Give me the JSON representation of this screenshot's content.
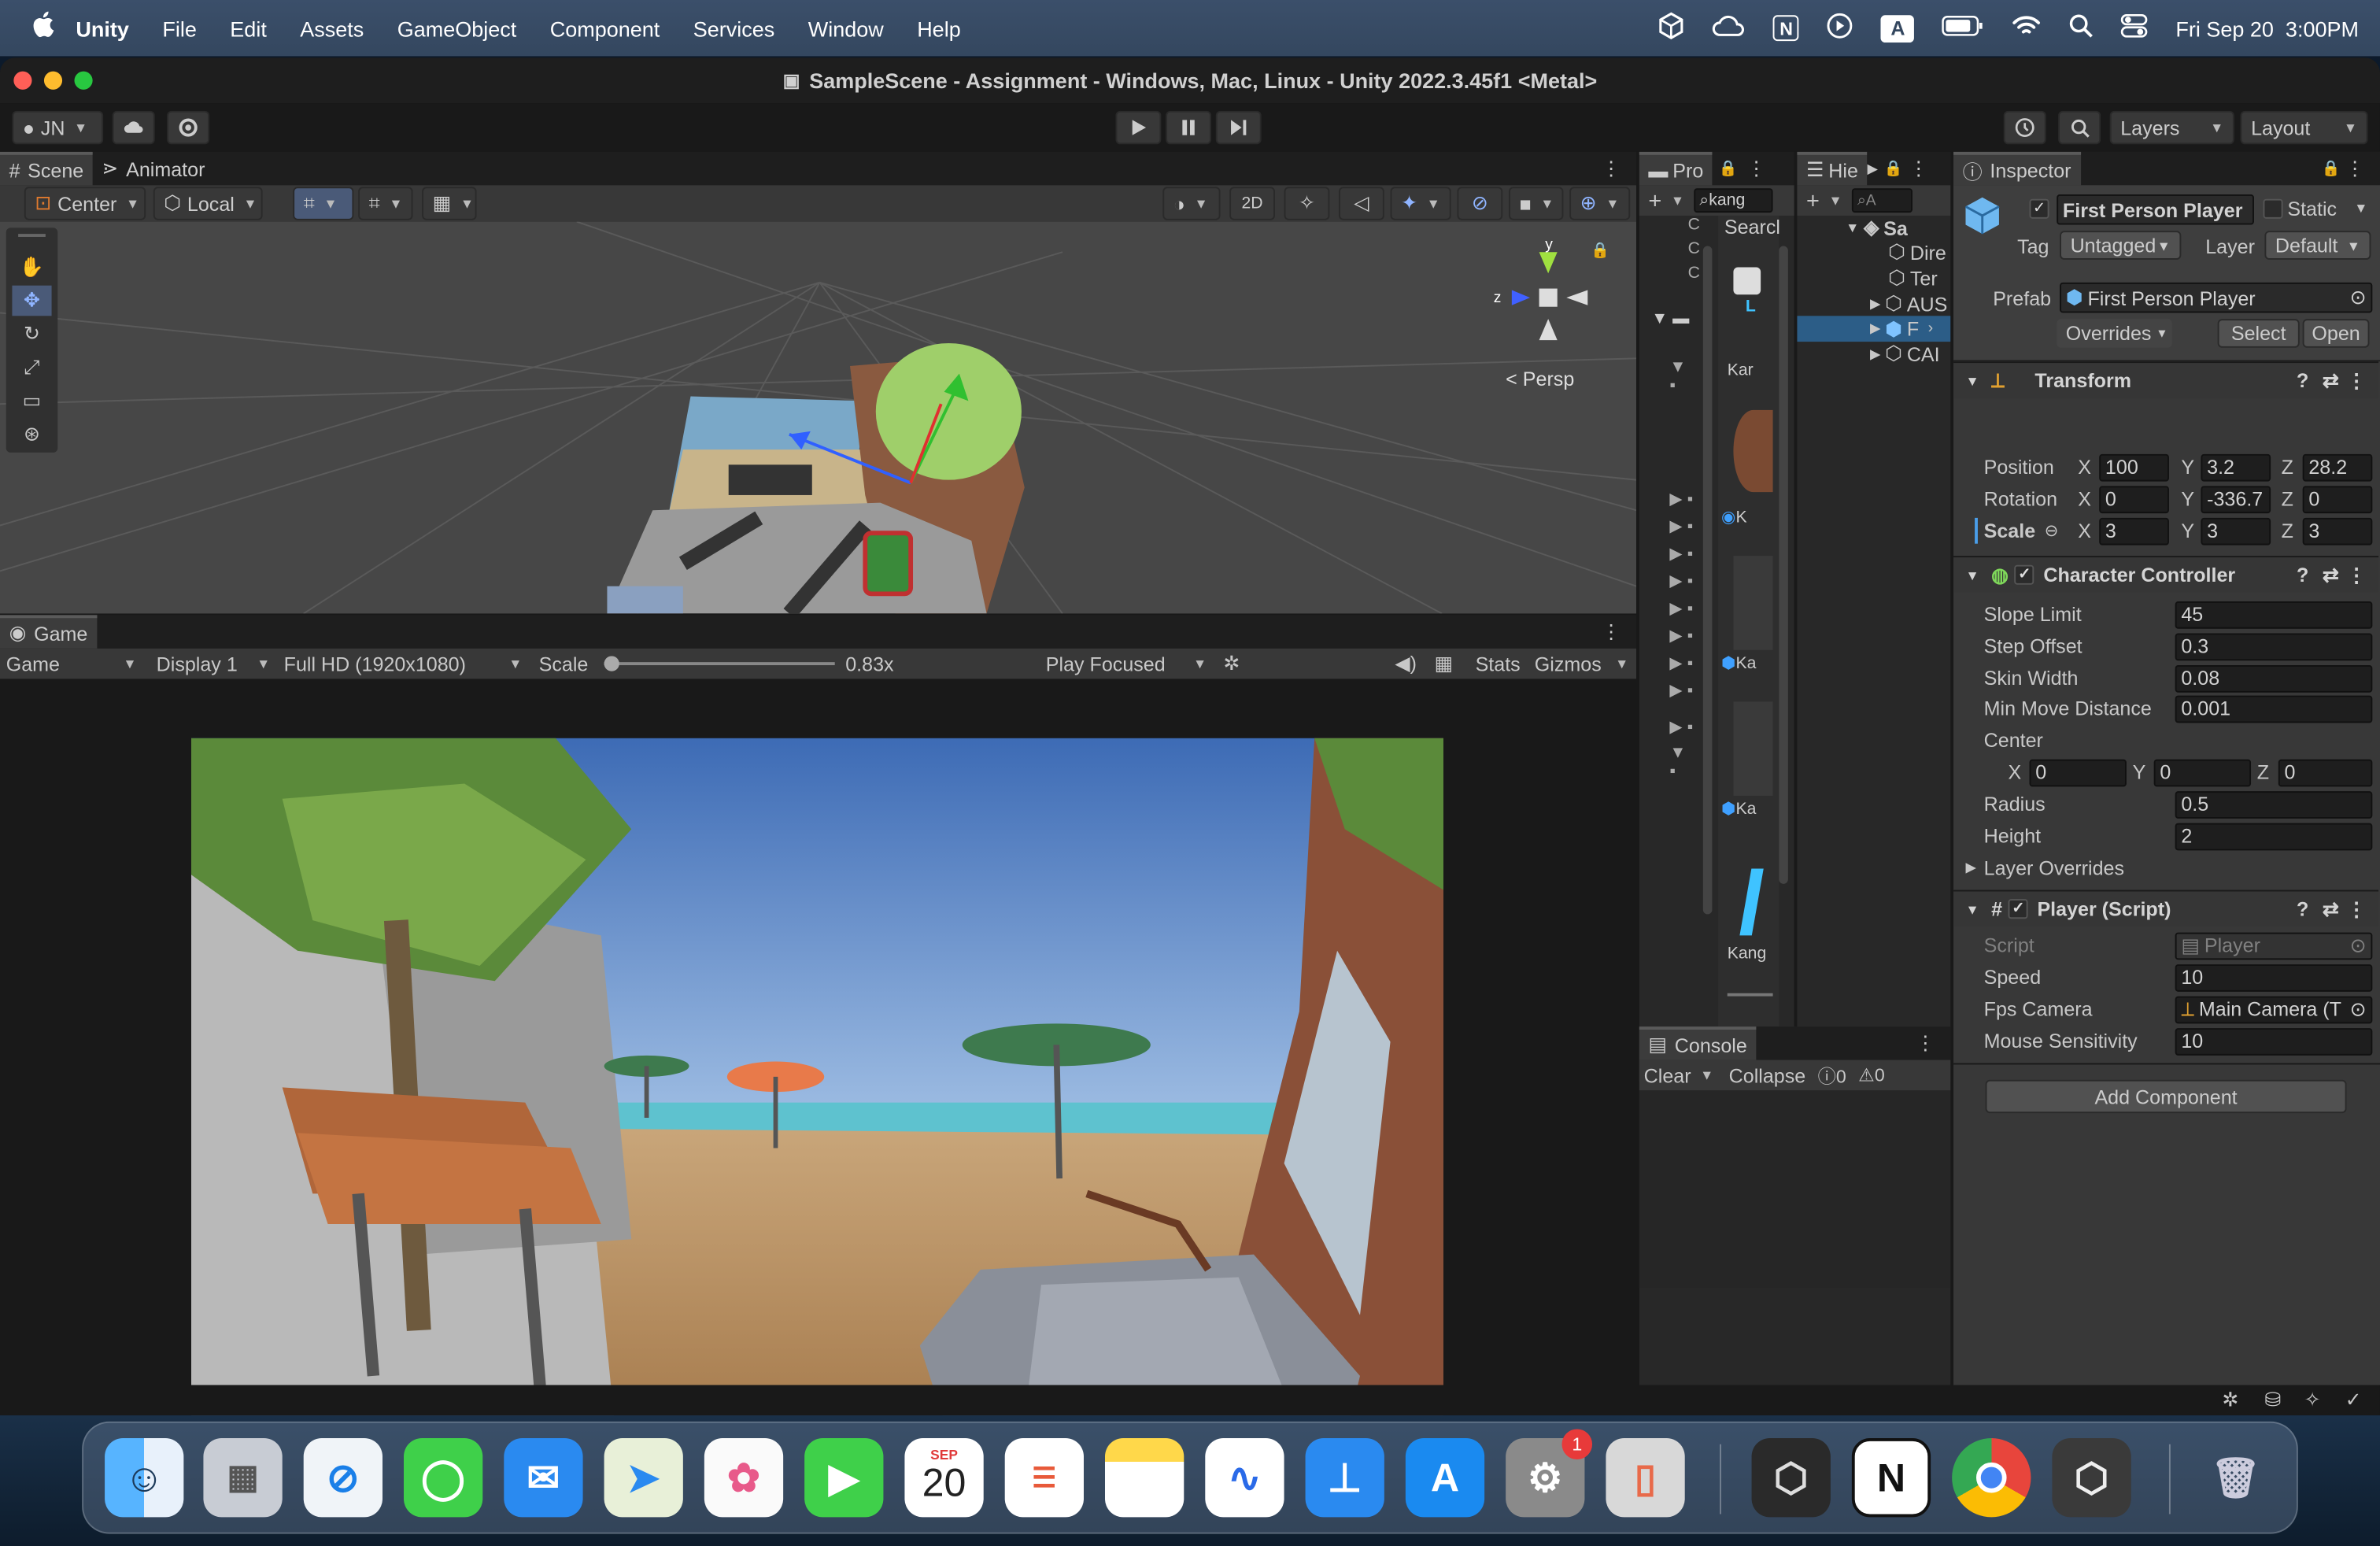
{
  "menubar": {
    "app": "Unity",
    "items": [
      "File",
      "Edit",
      "Assets",
      "GameObject",
      "Component",
      "Services",
      "Window",
      "Help"
    ],
    "datetime": "Fri Sep 20  3:00PM",
    "keyboard": "A"
  },
  "window": {
    "title": "SampleScene - Assignment - Windows, Mac, Linux - Unity 2022.3.45f1 <Metal>"
  },
  "toolbar": {
    "account": "JN",
    "layers": "Layers",
    "layout": "Layout"
  },
  "scene": {
    "tab_scene": "Scene",
    "tab_animator": "Animator",
    "pivot": "Center",
    "space": "Local",
    "mode_2d": "2D",
    "persp": "Persp",
    "axis_y": "y",
    "axis_z": "z"
  },
  "game": {
    "tab": "Game",
    "view": "Game",
    "display": "Display 1",
    "resolution": "Full HD (1920x1080)",
    "scale_label": "Scale",
    "scale_value": "0.83x",
    "scale_fraction": 0.02,
    "play_mode": "Play Focused",
    "stats": "Stats",
    "gizmos": "Gizmos"
  },
  "project": {
    "tab": "Pro",
    "search": "kang",
    "search_label": "Searcl",
    "items": [
      "Kar",
      "K",
      "Ka",
      "Ka",
      "Kang"
    ]
  },
  "hierarchy": {
    "tab": "Hie",
    "search_placeholder": "A",
    "scene": "Sa",
    "items": [
      "Dire",
      "Ter",
      "AUS",
      "F",
      "CAI"
    ]
  },
  "console": {
    "tab": "Console",
    "clear": "Clear",
    "collapse": "Collapse",
    "errors": "0",
    "warnings": "0"
  },
  "inspector": {
    "tab": "Inspector",
    "object_name": "First Person Player",
    "static": "Static",
    "tag_label": "Tag",
    "tag": "Untagged",
    "layer_label": "Layer",
    "layer": "Default",
    "prefab_label": "Prefab",
    "prefab": "First Person Player",
    "overrides": "Overrides",
    "select": "Select",
    "open": "Open",
    "transform": {
      "title": "Transform",
      "position_label": "Position",
      "rotation_label": "Rotation",
      "scale_label": "Scale",
      "position": {
        "x": "100",
        "y": "3.2",
        "z": "28.2"
      },
      "rotation": {
        "x": "0",
        "y": "-336.7",
        "z": "0"
      },
      "scale": {
        "x": "3",
        "y": "3",
        "z": "3"
      }
    },
    "character_controller": {
      "title": "Character Controller",
      "slope_limit_label": "Slope Limit",
      "slope_limit": "45",
      "step_offset_label": "Step Offset",
      "step_offset": "0.3",
      "skin_width_label": "Skin Width",
      "skin_width": "0.08",
      "min_move_label": "Min Move Distance",
      "min_move": "0.001",
      "center_label": "Center",
      "center": {
        "x": "0",
        "y": "0",
        "z": "0"
      },
      "radius_label": "Radius",
      "radius": "0.5",
      "height_label": "Height",
      "height": "2",
      "layer_overrides": "Layer Overrides"
    },
    "player_script": {
      "title": "Player (Script)",
      "script_label": "Script",
      "script": "Player",
      "speed_label": "Speed",
      "speed": "10",
      "fps_camera_label": "Fps Camera",
      "fps_camera": "Main Camera (T",
      "mouse_label": "Mouse Sensitivity",
      "mouse": "10"
    },
    "add_component": "Add Component",
    "axis": {
      "x": "X",
      "y": "Y",
      "z": "Z"
    }
  },
  "dock": {
    "calendar_month": "SEP",
    "calendar_day": "20",
    "settings_badge": "1",
    "notion": "N"
  }
}
